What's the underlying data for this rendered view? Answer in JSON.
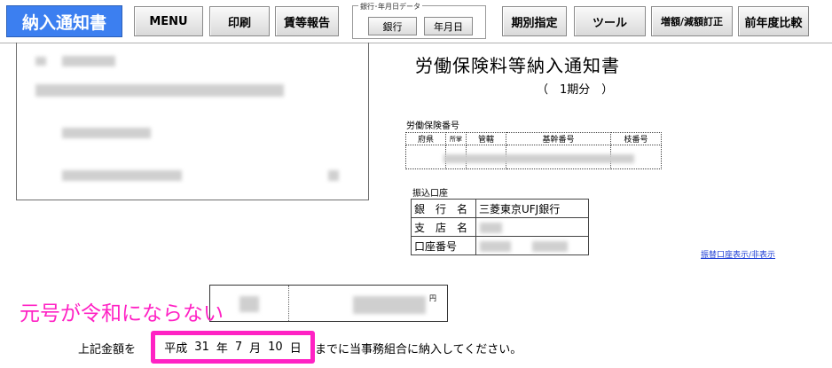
{
  "toolbar": {
    "title": "納入通知書",
    "menu": "MENU",
    "print": "印刷",
    "wage_report": "賃等報告",
    "bank_group_title": "銀行･年月日データ",
    "bank": "銀行",
    "date": "年月日",
    "period_setting": "期別指定",
    "tools": "ツール",
    "inc_dec": "増額/減額訂正",
    "prev_year": "前年度比較"
  },
  "notice": {
    "title": "労働保険料等納入通知書",
    "period": "（　1期分　）"
  },
  "insurance": {
    "label": "労働保険番号",
    "headers": [
      "府県",
      "所掌",
      "管轄",
      "基幹番号",
      "枝番号"
    ]
  },
  "account": {
    "label": "振込口座",
    "rows": [
      {
        "label": "銀　行　名",
        "value": "三菱東京UFJ銀行"
      },
      {
        "label": "支　店　名",
        "value": ""
      },
      {
        "label": "口座番号",
        "value": ""
      }
    ],
    "toggle_link": "振替口座表示/非表示"
  },
  "amount": {
    "yen": "円"
  },
  "annotation": "元号が令和にならない",
  "payment": {
    "prefix": "上記金額を",
    "era": "平成",
    "year": "31",
    "year_unit": "年",
    "month": "7",
    "month_unit": "月",
    "day": "10",
    "day_unit": "日",
    "suffix": "までに当事務組合に納入してください。"
  },
  "colors": {
    "title_button": "#3c7ff0",
    "annotation": "#ff22c4",
    "link": "#1f3fd6"
  }
}
